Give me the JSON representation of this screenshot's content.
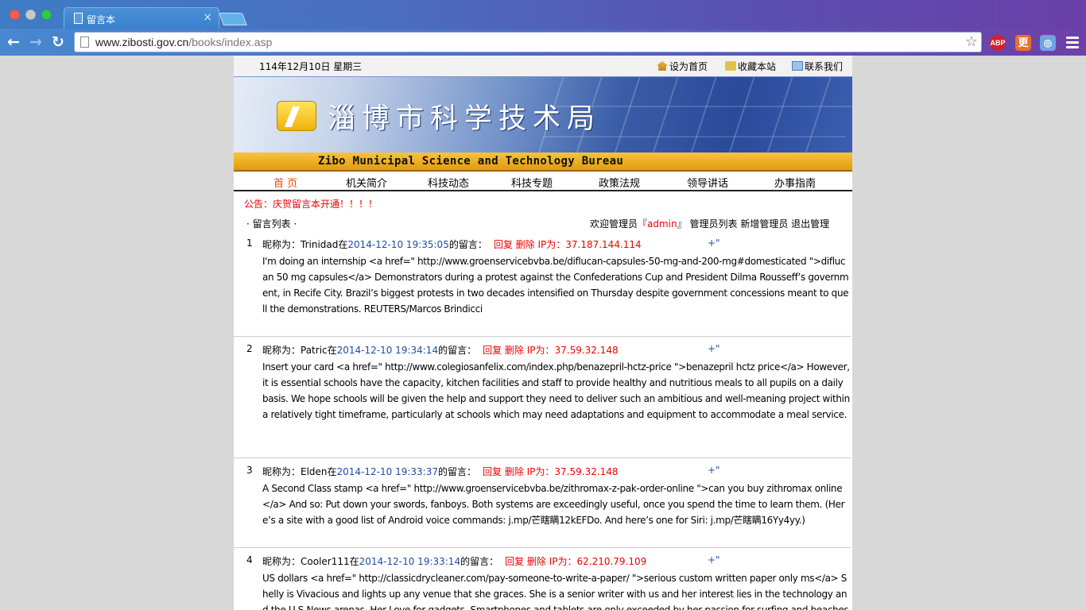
{
  "browser": {
    "tab_title": "留言本",
    "tab_close": "×",
    "url_host": "www.zibosti.gov.cn",
    "url_path": "/books/index.asp",
    "extensions": [
      "ABP",
      "更",
      "◎"
    ]
  },
  "topbar": {
    "date": "114年12月10日 星期三",
    "set_home": "设为首页",
    "bookmark": "收藏本站",
    "contact": "联系我们"
  },
  "banner": {
    "cn_title": "淄博市科学技术局",
    "en_title": "Zibo Municipal Science and Technology Bureau"
  },
  "nav": [
    "首 页",
    "机关简介",
    "科技动态",
    "科技专题",
    "政策法规",
    "领导讲话",
    "办事指南"
  ],
  "notice": "公告：庆贺留言本开通！！！！",
  "list_header": "· 留言列表 ·",
  "admin": {
    "welcome_prefix": "欢迎管理员『",
    "name": "admin",
    "welcome_suffix": "』",
    "admin_list": "管理员列表",
    "add_admin": "新增管理员",
    "logout": "退出管理"
  },
  "messages": [
    {
      "num": "1",
      "nick_prefix": "昵称为：Trinidad在",
      "time": "2014-12-10 19:35:05",
      "time_suffix": "的留言：",
      "actions": "回复 删除 IP为：37.187.144.114",
      "plus": "+\"",
      "body": "I'm doing an internship <a href=\" http://www.groenservicebvba.be/diflucan-capsules-50-mg-and-200-mg#domesticated \">diflucan 50 mg capsules</a>  Demonstrators during a protest against the Confederations Cup and President Dilma Rousseff’s government, in Recife City. Brazil’s biggest protests in two decades intensified on Thursday despite government concessions meant to quell the demonstrations. REUTERS/Marcos Brindicci"
    },
    {
      "num": "2",
      "nick_prefix": "昵称为：Patric在",
      "time": "2014-12-10 19:34:14",
      "time_suffix": "的留言：",
      "actions": "回复 删除 IP为：37.59.32.148",
      "plus": "+\"",
      "body": "Insert your card <a href=\" http://www.colegiosanfelix.com/index.php/benazepril-hctz-price \">benazepril hctz price</a>  However, it is essential schools have the capacity, kitchen facilities and staff to provide healthy and nutritious meals to all pupils on a daily basis. We hope schools will be given the help and support they need to deliver such an ambitious and well-meaning project within a relatively tight timeframe, particularly at schools which may need adaptations and equipment to accommodate a meal service."
    },
    {
      "num": "3",
      "nick_prefix": "昵称为：Elden在",
      "time": "2014-12-10 19:33:37",
      "time_suffix": "的留言：",
      "actions": "回复 删除 IP为：37.59.32.148",
      "plus": "+\"",
      "body": "A Second Class stamp <a href=\" http://www.groenservicebvba.be/zithromax-z-pak-order-online \">can you buy zithromax online</a>  And so: Put down your swords, fanboys. Both systems are exceedingly useful, once you spend the time to learn them. (Here’s a site with a good list of Android voice commands: j.mp/芒瞎瞒12kEFDo. And here’s one for Siri: j.mp/芒瞎瞒16Yy4yy.)"
    },
    {
      "num": "4",
      "nick_prefix": "昵称为：Cooler111在",
      "time": "2014-12-10 19:33:14",
      "time_suffix": "的留言：",
      "actions": "回复 删除 IP为：62.210.79.109",
      "plus": "+\"",
      "body": "US dollars <a href=\" http://classicdrycleaner.com/pay-someone-to-write-a-paper/ \">serious custom written paper only ms</a>  Shelly is Vivacious and lights up any venue that she graces. She is a senior writer with us and her interest lies in the technology and the U.S News arenas. Her Love for gadgets, Smartphones and tablets are only exceeded by her passion for surfing and beaches"
    }
  ]
}
